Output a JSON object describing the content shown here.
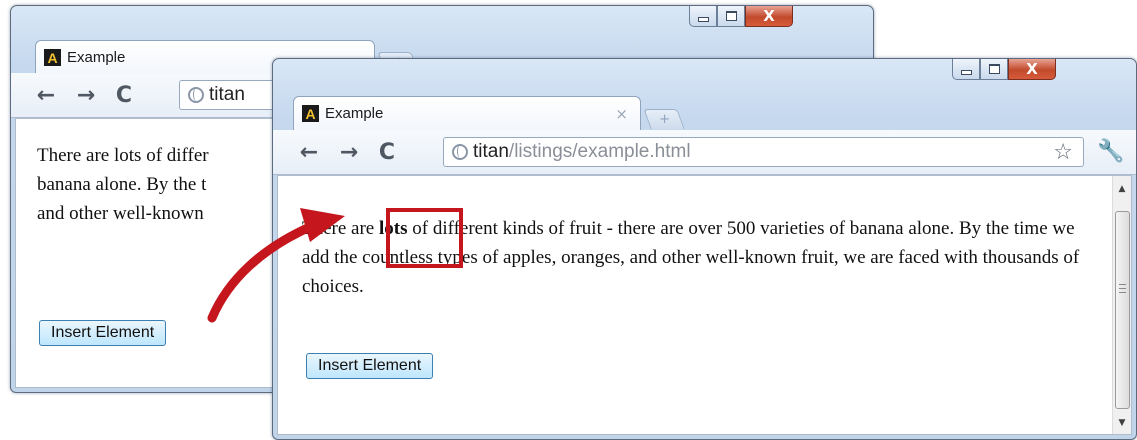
{
  "back_window": {
    "tab_title": "Example",
    "url_host": "titan",
    "paragraph": "There are lots of differ banana alone. By the t and other well-known",
    "lines": [
      "There are lots of differ",
      "banana alone. By the t",
      "and other well-known"
    ],
    "button_label": "Insert Element"
  },
  "front_window": {
    "tab_title": "Example",
    "tab_close": "×",
    "url_host": "titan",
    "url_path": "/listings/example.html",
    "paragraph_before": "There are ",
    "paragraph_bold": "lots",
    "paragraph_after": " of different kinds of fruit - there are over 500 varieties of banana alone. By the time we add the countless types of apples, oranges, and other well-known fruit, we are faced with thousands of choices.",
    "button_label": "Insert Element"
  },
  "icons": {
    "favicon": "A",
    "back": "←",
    "forward": "→",
    "reload": "C",
    "star": "☆",
    "wrench": "🔧",
    "new_tab": "+"
  },
  "colors": {
    "annotation": "#c4161c",
    "button_border": "#3c7fb1",
    "close_button": "#c24a2c"
  }
}
